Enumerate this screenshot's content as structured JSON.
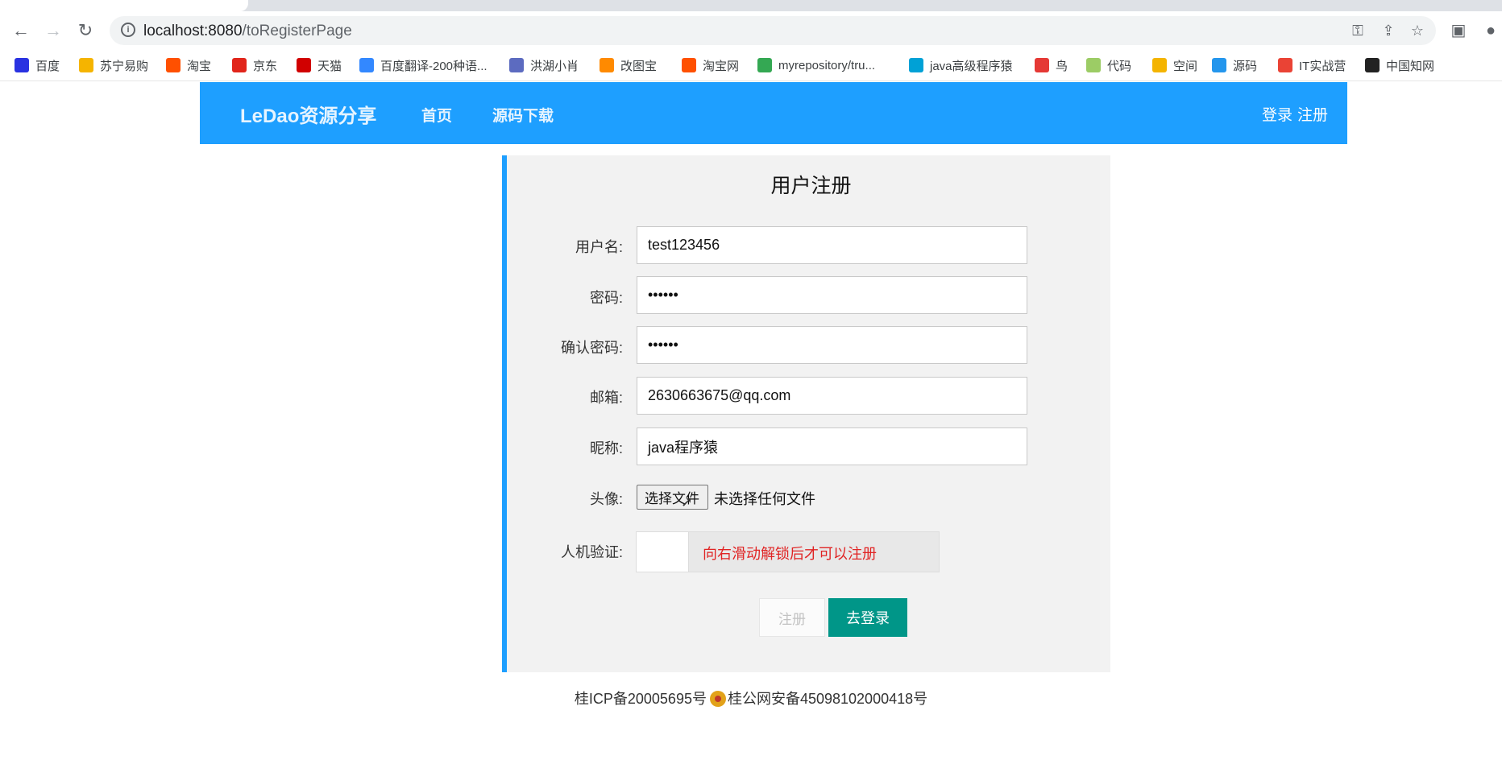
{
  "browser": {
    "url_host": "localhost:8080",
    "url_path": "/toRegisterPage",
    "bookmarks": [
      {
        "label": "百度",
        "icon": "baidu-icon",
        "color": "#2932e1"
      },
      {
        "label": "苏宁易购",
        "icon": "suning-icon",
        "color": "#f5b400"
      },
      {
        "label": "淘宝",
        "icon": "taobao-icon",
        "color": "#ff5000"
      },
      {
        "label": "京东",
        "icon": "jd-icon",
        "color": "#e1251b"
      },
      {
        "label": "天猫",
        "icon": "tmall-icon",
        "color": "#d10000"
      },
      {
        "label": "百度翻译-200种语...",
        "icon": "baidu-translate-icon",
        "color": "#3388ff"
      },
      {
        "label": "洪湖小肖",
        "icon": "bookmark-icon",
        "color": "#5c6bc0"
      },
      {
        "label": "改图宝",
        "icon": "gaitubao-icon",
        "color": "#ff8a00"
      },
      {
        "label": "淘宝网",
        "icon": "taobao-icon",
        "color": "#ff5000"
      },
      {
        "label": "myrepository/tru...",
        "icon": "chrome-icon",
        "color": "#34a853"
      },
      {
        "label": "java高级程序猿",
        "icon": "bilibili-icon",
        "color": "#00a1d6"
      },
      {
        "label": "鸟",
        "icon": "bird-icon",
        "color": "#e53935"
      },
      {
        "label": "代码",
        "icon": "code-icon",
        "color": "#9ccc65"
      },
      {
        "label": "空间",
        "icon": "qzone-icon",
        "color": "#f4b400"
      },
      {
        "label": "源码",
        "icon": "docker-icon",
        "color": "#2496ed"
      },
      {
        "label": "IT实战营",
        "icon": "chrome-icon",
        "color": "#ea4335"
      },
      {
        "label": "中国知网",
        "icon": "cnki-icon",
        "color": "#222222"
      }
    ]
  },
  "header": {
    "brand": "LeDao资源分享",
    "nav": [
      "首页",
      "源码下载"
    ],
    "login": "登录",
    "register": "注册"
  },
  "form": {
    "title": "用户注册",
    "username_label": "用户名:",
    "username_value": "test123456",
    "password_label": "密码:",
    "password_value": "••••••",
    "confirm_label": "确认密码:",
    "confirm_value": "••••••",
    "email_label": "邮箱:",
    "email_value": "2630663675@qq.com",
    "nickname_label": "昵称:",
    "nickname_value": "java程序猿",
    "avatar_label": "头像:",
    "file_button": "选择文件",
    "file_status": "未选择任何文件",
    "captcha_label": "人机验证:",
    "slider_text": "向右滑动解锁后才可以注册",
    "register_button": "注册",
    "login_button": "去登录"
  },
  "footer": {
    "icp": "桂ICP备20005695号",
    "police": "桂公网安备45098102000418号"
  },
  "colors": {
    "accent": "#1e9fff",
    "login_button": "#009688",
    "slider_text": "#e02424"
  }
}
